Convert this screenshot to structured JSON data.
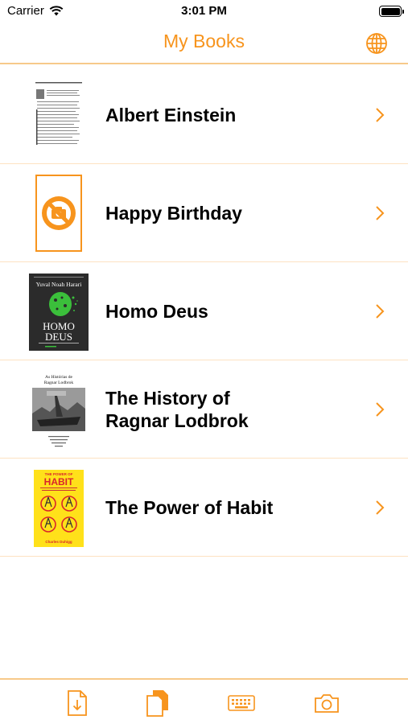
{
  "status_bar": {
    "carrier": "Carrier",
    "time": "3:01 PM"
  },
  "nav": {
    "title": "My Books",
    "globe_icon": "globe-icon"
  },
  "books": [
    {
      "title": "Albert Einstein",
      "cover": "document-scan-cover"
    },
    {
      "title": "Happy Birthday",
      "cover": "no-image-placeholder"
    },
    {
      "title": "Homo Deus",
      "cover": "homo-deus-cover",
      "cover_author": "Yuval Noah Harari",
      "cover_title_line1": "HOMO",
      "cover_title_line2": "DEUS"
    },
    {
      "title": "The History of Ragnar Lodbrok",
      "title_line1": "The History of",
      "title_line2": "Ragnar Lodbrok",
      "cover": "ragnar-cover",
      "cover_heading_line1": "As Histórias de",
      "cover_heading_line2": "Ragnar Lodbrok"
    },
    {
      "title": "The Power of Habit",
      "cover": "power-of-habit-cover",
      "cover_top": "THE POWER OF",
      "cover_big": "HABIT",
      "cover_author": "Charles Duhigg"
    }
  ],
  "tabs": [
    {
      "icon": "import-file-icon"
    },
    {
      "icon": "documents-icon"
    },
    {
      "icon": "keyboard-icon"
    },
    {
      "icon": "camera-icon"
    }
  ],
  "colors": {
    "accent": "#f7941d",
    "separator": "#fde2c2",
    "nav_border": "#f7c98a",
    "homo_deus_bg": "#2b2b2b",
    "habit_bg": "#ffe11a"
  }
}
